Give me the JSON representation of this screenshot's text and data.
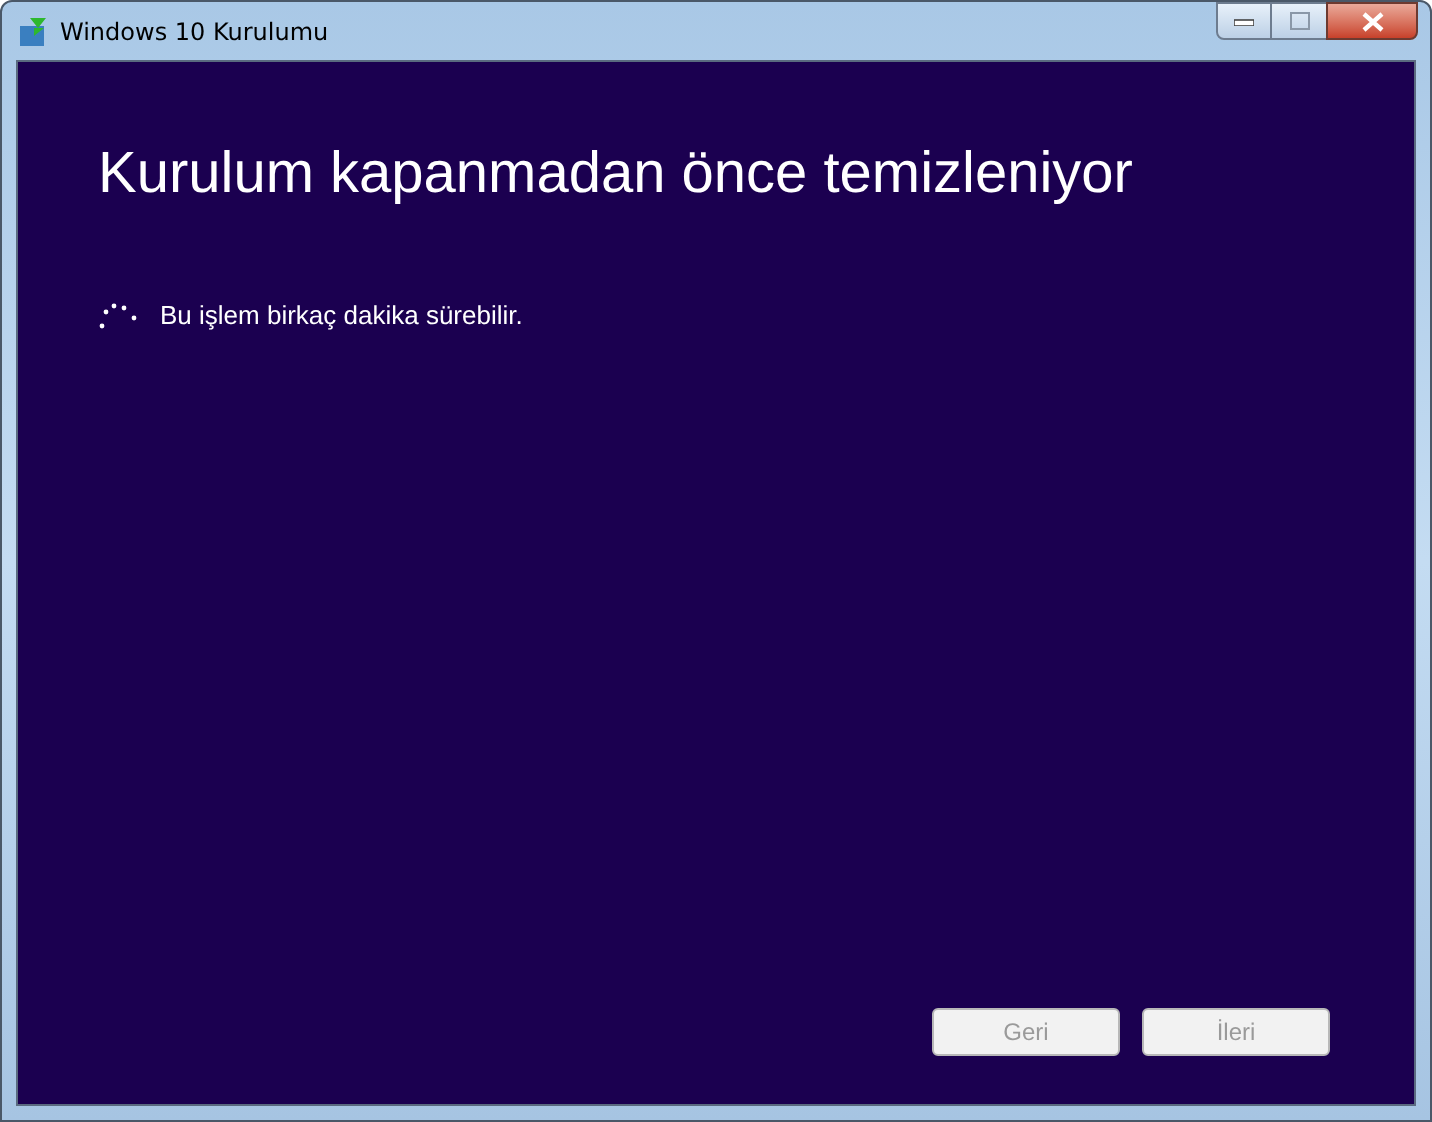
{
  "window": {
    "title": "Windows 10 Kurulumu"
  },
  "heading": "Kurulum kapanmadan önce temizleniyor",
  "status": "Bu işlem birkaç dakika sürebilir.",
  "buttons": [
    {
      "label": "Geri",
      "disabled": true
    },
    {
      "label": "İleri",
      "disabled": true
    }
  ]
}
